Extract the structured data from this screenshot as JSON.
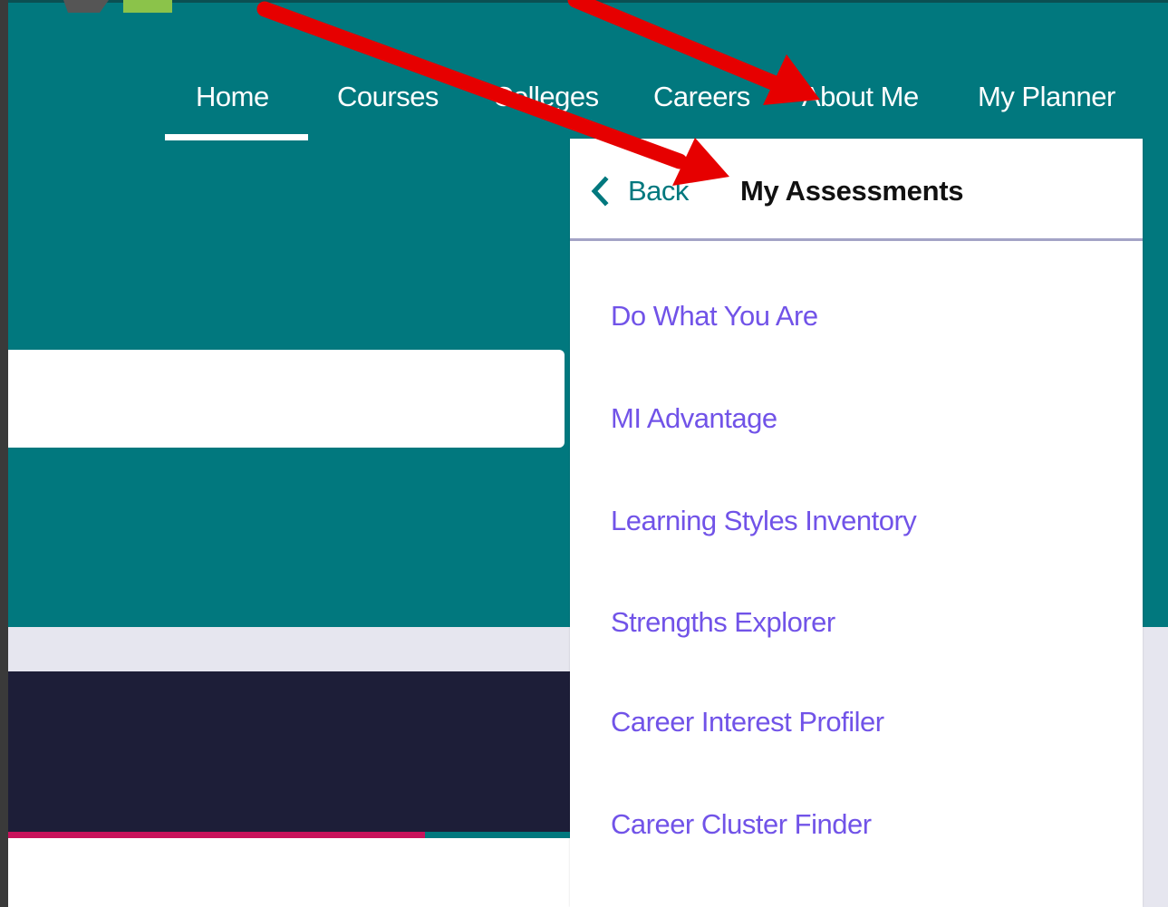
{
  "nav": {
    "items": [
      {
        "label": "Home",
        "active": true
      },
      {
        "label": "Courses"
      },
      {
        "label": "Colleges"
      },
      {
        "label": "Careers"
      },
      {
        "label": "About Me"
      },
      {
        "label": "My Planner"
      }
    ]
  },
  "dropdown": {
    "back_label": "Back",
    "title": "My Assessments",
    "items": [
      {
        "label": "Do What You Are"
      },
      {
        "label": "MI Advantage"
      },
      {
        "label": "Learning Styles Inventory"
      },
      {
        "label": "Strengths Explorer"
      },
      {
        "label": "Career Interest Profiler"
      },
      {
        "label": "Career Cluster Finder"
      }
    ]
  },
  "colors": {
    "header_teal": "#01787e",
    "link_purple": "#7153e8",
    "annotation_red": "#e60000",
    "dark_band": "#1d1e38",
    "accent_pink": "#c8125b"
  },
  "icons": {
    "back": "chevron-left-icon"
  }
}
